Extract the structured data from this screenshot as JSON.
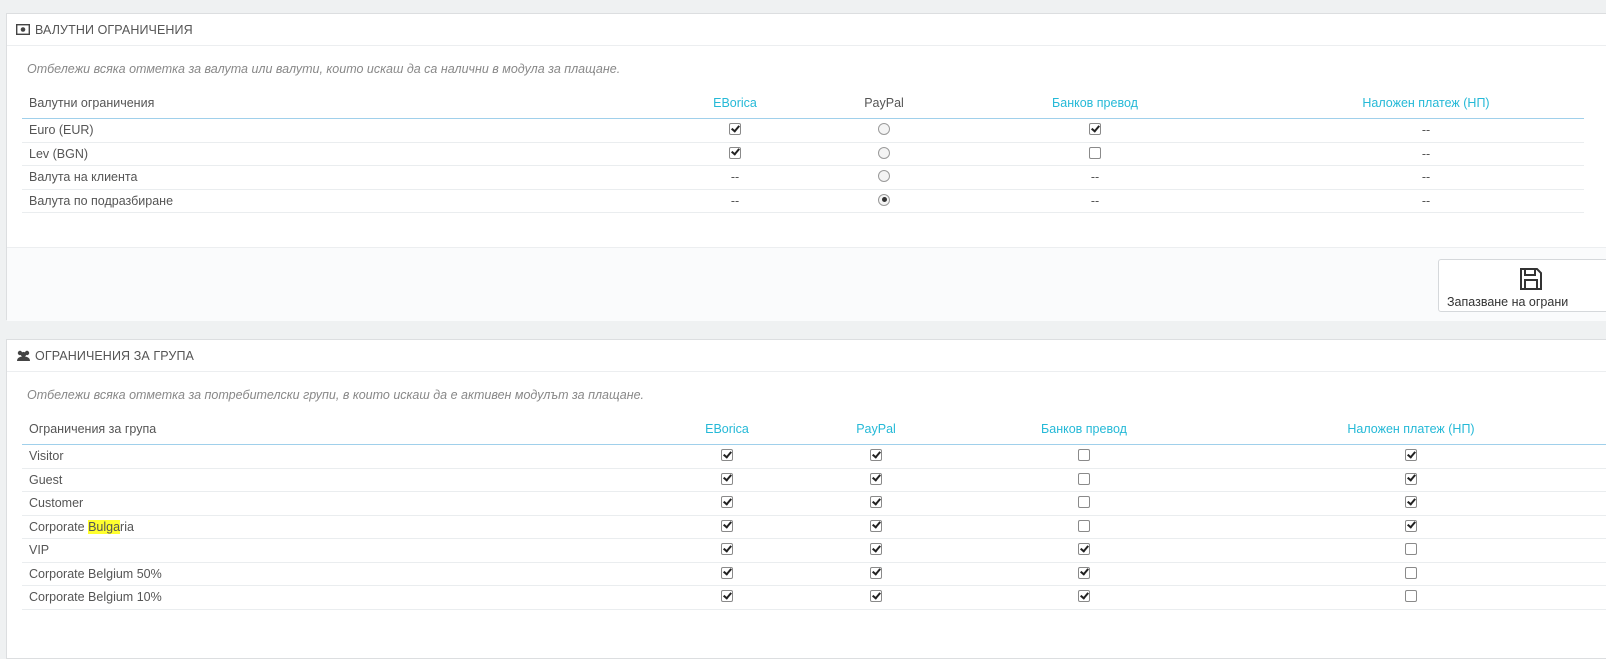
{
  "currency": {
    "title": "Валутни ограничения",
    "hint": "Отбележи всяка отметка за валута или валути, които искаш да са налични в модула за плащане.",
    "columns": [
      "Валутни ограничения",
      "EBorica",
      "PayPal",
      "Банков превод",
      "Наложен платеж (НП)"
    ],
    "rows": [
      {
        "label": "Euro (EUR)",
        "cells": [
          "checked",
          "radio",
          "checked",
          "--"
        ]
      },
      {
        "label": "Lev (BGN)",
        "cells": [
          "checked",
          "radio",
          "unchecked",
          "--"
        ]
      },
      {
        "label": "Валута на клиента",
        "cells": [
          "--",
          "radio",
          "--",
          "--"
        ]
      },
      {
        "label": "Валута по подразбиране",
        "cells": [
          "--",
          "radio-selected",
          "--",
          "--"
        ]
      }
    ],
    "save_label": "Запазване на ограни"
  },
  "groups": {
    "title": "Ограничения за група",
    "hint": "Отбележи всяка отметка за потребителски групи, в които искаш да е активен модулът за плащане.",
    "columns": [
      "Ограничения за група",
      "EBorica",
      "PayPal",
      "Банков превод",
      "Наложен платеж (НП)"
    ],
    "rows": [
      {
        "label": "Visitor",
        "cells": [
          "checked",
          "checked",
          "unchecked",
          "checked"
        ]
      },
      {
        "label": "Guest",
        "cells": [
          "checked",
          "checked",
          "unchecked",
          "checked"
        ]
      },
      {
        "label": "Customer",
        "cells": [
          "checked",
          "checked",
          "unchecked",
          "checked"
        ]
      },
      {
        "label": "Corporate Bulgaria",
        "label_pre": "Corporate ",
        "label_mark": "Bulga",
        "label_post": "ria",
        "cells": [
          "checked",
          "checked",
          "unchecked",
          "checked"
        ]
      },
      {
        "label": "VIP",
        "cells": [
          "checked",
          "checked",
          "checked",
          "unchecked"
        ]
      },
      {
        "label": "Corporate Belgium 50%",
        "cells": [
          "checked",
          "checked",
          "checked",
          "unchecked"
        ]
      },
      {
        "label": "Corporate Belgium 10%",
        "cells": [
          "checked",
          "checked",
          "checked",
          "unchecked"
        ]
      }
    ]
  },
  "colors": {
    "link": "#25b9d7",
    "highlight": "#ffff2f",
    "background": "#eff1f2"
  },
  "icons": {
    "currency": "money-icon",
    "groups": "users-icon",
    "save": "floppy-disk-icon"
  }
}
